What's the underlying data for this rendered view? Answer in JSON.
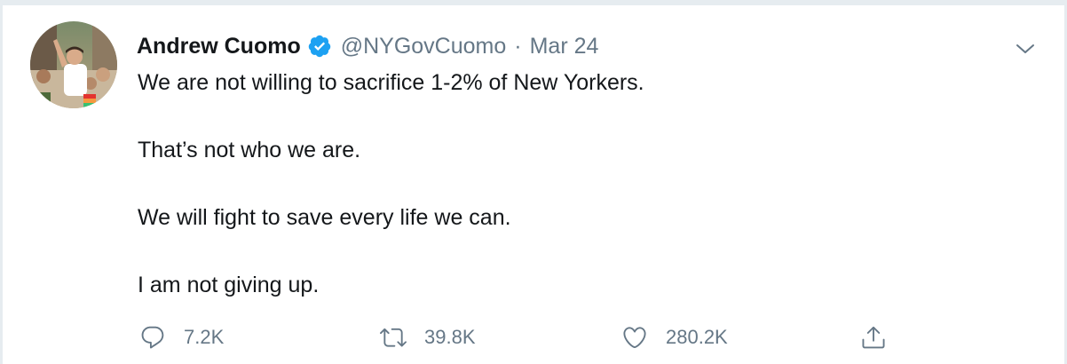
{
  "tweet": {
    "author_name": "Andrew Cuomo",
    "handle": "@NYGovCuomo",
    "separator": "·",
    "date": "Mar 24",
    "paragraphs": [
      "We are not willing to sacrifice 1-2% of New Yorkers.",
      "That’s not who we are.",
      "We will fight to save every life we can.",
      "I am not giving up."
    ]
  },
  "actions": {
    "replies": "7.2K",
    "retweets": "39.8K",
    "likes": "280.2K"
  },
  "icons": {
    "verified": "verified-badge-icon",
    "caret": "chevron-down-icon",
    "reply": "reply-icon",
    "retweet": "retweet-icon",
    "like": "heart-icon",
    "share": "share-icon"
  },
  "colors": {
    "verified_blue": "#1da1f2",
    "secondary_text": "#657786",
    "primary_text": "#14171a",
    "border": "#e6ecf0"
  }
}
